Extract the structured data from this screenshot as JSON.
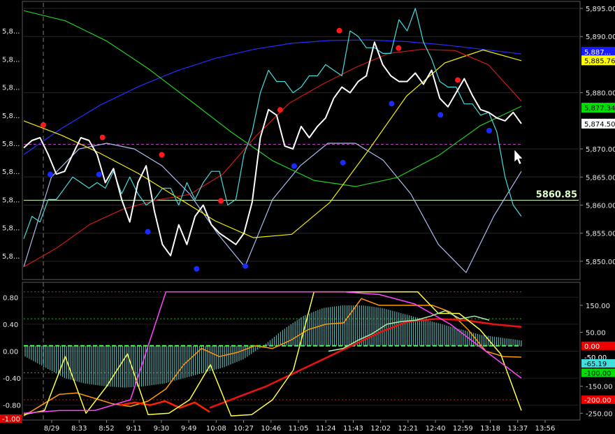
{
  "chart_data": [
    {
      "type": "line",
      "title": "",
      "xlabel": "",
      "ylabel": "",
      "ylim": [
        5847,
        5896
      ],
      "grid": true,
      "left_axis_labels": [
        "5,8...",
        "5,8...",
        "5,8...",
        "5,8...",
        "5,8...",
        "5,8...",
        "5,8...",
        "5,8...",
        "5,8..."
      ],
      "right_axis_ticks": [
        {
          "value": 5895,
          "label": "5,895.00"
        },
        {
          "value": 5890,
          "label": "5,890.00"
        },
        {
          "value": 5880,
          "label": "5,880.00"
        },
        {
          "value": 5870,
          "label": "5,870.00"
        },
        {
          "value": 5865,
          "label": "5,865.00"
        },
        {
          "value": 5860,
          "label": "5,860.00"
        },
        {
          "value": 5855,
          "label": "5,855.00"
        },
        {
          "value": 5850,
          "label": "5,850.00"
        }
      ],
      "price_markers": [
        {
          "label": "5,887...",
          "value": 5887.3,
          "color": "#1a1aff",
          "text_color": "#ffffff"
        },
        {
          "label": "5,885.76",
          "value": 5885.76,
          "color": "#ffff00",
          "text_color": "#000000"
        },
        {
          "label": "5,877.34",
          "value": 5877.34,
          "color": "#00dd00",
          "text_color": "#000000"
        },
        {
          "label": "5,874.50",
          "value": 5874.5,
          "color": "#ffffff",
          "text_color": "#000000"
        }
      ],
      "horizontal_line": {
        "value": 5860.85,
        "label": "5860.85",
        "color": "#ddffcc"
      },
      "dashed_level": {
        "value": 5870.8,
        "color": "#cc44cc"
      },
      "series": [
        {
          "color": "#ffffff",
          "values": [
            5870.2,
            5871.5,
            5872,
            5869,
            5865.5,
            5866,
            5869,
            5872,
            5871.5,
            5869,
            5864,
            5866.5,
            5861,
            5857,
            5864,
            5867,
            5859,
            5853,
            5851,
            5856.5,
            5853,
            5858,
            5860,
            5856.5,
            5855,
            5854,
            5853,
            5855,
            5860.5,
            5872,
            5877,
            5876,
            5870.5,
            5870,
            5874,
            5872,
            5874,
            5875.5,
            5879,
            5881,
            5880,
            5882,
            5883,
            5889,
            5885,
            5883,
            5882,
            5882,
            5883.5,
            5881.5,
            5884,
            5879,
            5877.5,
            5880,
            5882.5,
            5879.5,
            5877,
            5876.5,
            5875.5,
            5875,
            5876.5,
            5874.5
          ]
        },
        {
          "color": "#44dddd",
          "values": [
            5854,
            5858,
            5857,
            5861,
            5861,
            5863,
            5865,
            5864,
            5863,
            5864,
            5863,
            5866,
            5862,
            5865,
            5862,
            5860,
            5861,
            5863,
            5863,
            5860,
            5864,
            5861,
            5864,
            5866,
            5866,
            5860,
            5861,
            5869,
            5873,
            5880,
            5884,
            5882,
            5882,
            5880,
            5881,
            5883,
            5883,
            5885,
            5884,
            5883,
            5891,
            5890,
            5888,
            5888,
            5887,
            5887,
            5893,
            5891,
            5895,
            5889,
            5886,
            5882,
            5881,
            5881,
            5878,
            5878,
            5876,
            5876.5,
            5873,
            5865,
            5860,
            5858
          ]
        },
        {
          "color": "#2a2aff",
          "values": [
            5869,
            5873.7,
            5877.8,
            5881.1,
            5883.9,
            5886.1,
            5887.7,
            5888.8,
            5889.3,
            5889.4,
            5889.1,
            5888.5,
            5887.7,
            5886.9
          ]
        },
        {
          "color": "#22cc22",
          "values": [
            5894.6,
            5892.8,
            5889.2,
            5884.3,
            5878.7,
            5873,
            5867.9,
            5864.4,
            5863.3,
            5864.9,
            5868.8,
            5874.1,
            5877.6
          ]
        },
        {
          "color": "#eeee00",
          "values": [
            5875,
            5872.4,
            5869.2,
            5865.6,
            5861.4,
            5857.2,
            5854.2,
            5854.8,
            5860.5,
            5869.7,
            5879.4,
            5885.3,
            5887.6,
            5885.7
          ]
        },
        {
          "color": "#cc1a1a",
          "values": [
            5849,
            5852.4,
            5856.6,
            5859.3,
            5860.9,
            5861.9,
            5865.5,
            5872.3,
            5878.1,
            5881.5,
            5884.5,
            5887,
            5887.7,
            5887.5,
            5885,
            5878.5
          ]
        },
        {
          "color": "#aabbee",
          "values": [
            5849,
            5865,
            5870,
            5871,
            5870,
            5867,
            5862,
            5855,
            5849,
            5861,
            5867,
            5871,
            5871,
            5868,
            5862,
            5853,
            5848,
            5858,
            5866
          ]
        }
      ],
      "marker_points_red": [
        5873.5,
        5871.3,
        5868.2,
        5860,
        5876.2,
        5890.3,
        5887.2,
        5881.5
      ],
      "marker_points_blue": [
        5866.2,
        5866.2,
        5856,
        5849.4,
        5849.9,
        5867.7,
        5868.3,
        5878.8,
        5876.8,
        5874
      ]
    },
    {
      "type": "line",
      "title": "",
      "xlabel": "",
      "ylabel": "",
      "ylim_left": [
        -1.0,
        1.0
      ],
      "ylim_right": [
        -270,
        230
      ],
      "left_axis_ticks": [
        {
          "value": 0.8,
          "label": "0.80"
        },
        {
          "value": 0.4,
          "label": "0.40"
        },
        {
          "value": 0.0,
          "label": "0.00"
        },
        {
          "value": -0.4,
          "label": "-0.40"
        },
        {
          "value": -0.8,
          "label": "-0.80"
        }
      ],
      "left_axis_marker": {
        "label": "-1.00",
        "value": -1.0,
        "color": "#dd0000"
      },
      "right_axis_ticks": [
        {
          "value": 150,
          "label": "150.00"
        },
        {
          "value": 50,
          "label": "50.00"
        },
        {
          "value": -150,
          "label": "-150.00"
        },
        {
          "value": -250,
          "label": "-250.00"
        }
      ],
      "right_axis_markers": [
        {
          "label": "0.00",
          "value": 0,
          "color": "#ee0000",
          "text_color": "#ffffff"
        },
        {
          "label": "-50.00",
          "value": -42,
          "color": "#000000",
          "text_color": "#ffffff"
        },
        {
          "label": "-65.19",
          "value": -65.19,
          "color": "#44dddd",
          "text_color": "#000000"
        },
        {
          "label": "-100.00",
          "value": -100,
          "color": "#00dd00",
          "text_color": "#000000"
        },
        {
          "label": "-200.00",
          "value": -200,
          "color": "#ee0000",
          "text_color": "#ffffff"
        }
      ],
      "reference_levels": [
        {
          "value": 200,
          "color": "#cc2222",
          "style": "dotted"
        },
        {
          "value": 100,
          "color": "#22bb22",
          "style": "dotted"
        },
        {
          "value": 0,
          "color": "#44ff44",
          "style": "dashed"
        },
        {
          "value": -100,
          "color": "#22bb22",
          "style": "dotted"
        },
        {
          "value": -200,
          "color": "#cc2222",
          "style": "dotted"
        }
      ],
      "histogram": {
        "color": "#6ecccc",
        "values": [
          -40,
          -80,
          -120,
          -140,
          -150,
          -155,
          -150,
          -140,
          -120,
          -100,
          -80,
          -50,
          0,
          60,
          110,
          140,
          150,
          150,
          140,
          120,
          100,
          80,
          60,
          40,
          30,
          20
        ]
      },
      "series": [
        {
          "color": "#ff9900",
          "values": [
            -260,
            -220,
            -180,
            -175,
            -195,
            -215,
            -225,
            -205,
            -160,
            -70,
            -10,
            -40,
            -25,
            0,
            -10,
            20,
            60,
            80,
            85,
            175,
            150,
            150,
            150,
            150,
            125,
            60,
            -20,
            -40,
            -42
          ]
        },
        {
          "color": "#ff2200",
          "values": [
            -220,
            -210,
            -220,
            -205,
            -230,
            -210,
            -245
          ]
        },
        {
          "color": "#ee1111",
          "values": [
            -230,
            -190,
            -150,
            -100,
            -50,
            0,
            50,
            90,
            100,
            95,
            80,
            70
          ]
        },
        {
          "color": "#ffff44",
          "values": [
            -255,
            -240,
            -40,
            -250,
            -150,
            -30,
            -255,
            -250,
            -200,
            -70,
            -260,
            -255,
            -200,
            -90,
            200,
            200,
            200,
            200,
            200,
            200,
            120,
            120,
            60,
            -30,
            -240
          ]
        },
        {
          "color": "#ff44ff",
          "values": [
            -250,
            -240,
            -240,
            -200,
            200,
            200,
            200,
            200,
            200,
            200,
            190,
            155,
            80,
            -20,
            -120
          ]
        },
        {
          "color": "#aaeeaa",
          "values": [
            -20,
            -10,
            20,
            45,
            80,
            90,
            95,
            110,
            130,
            100,
            110,
            95
          ]
        }
      ]
    }
  ],
  "time_axis": [
    "8/29",
    "8:33",
    "8:52",
    "9:11",
    "9:30",
    "9:49",
    "10:08",
    "10:27",
    "10:46",
    "11:05",
    "11:24",
    "11:43",
    "12:02",
    "12:21",
    "12:40",
    "12:59",
    "13:18",
    "13:37",
    "13:56"
  ]
}
